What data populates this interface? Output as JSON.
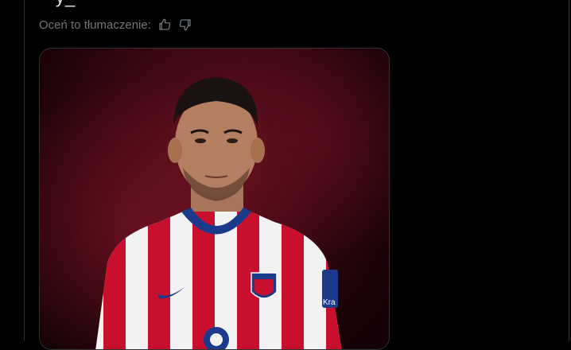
{
  "tweet": {
    "cut_off_text": "~ y_",
    "rate_translation": {
      "label": "Oceń to tłumaczenie:",
      "like_icon": "thumbs-up-icon",
      "dislike_icon": "thumbs-down-icon"
    },
    "media": {
      "alt": "Player presented in red and white striped kit",
      "jersey_sponsor_text": "Kra"
    }
  },
  "colors": {
    "background": "#000000",
    "border": "#2f3336",
    "text_secondary": "#71767b",
    "stripe_red": "#c8102e",
    "stripe_white": "#f2f2f2",
    "collar_blue": "#1b3a8a"
  }
}
